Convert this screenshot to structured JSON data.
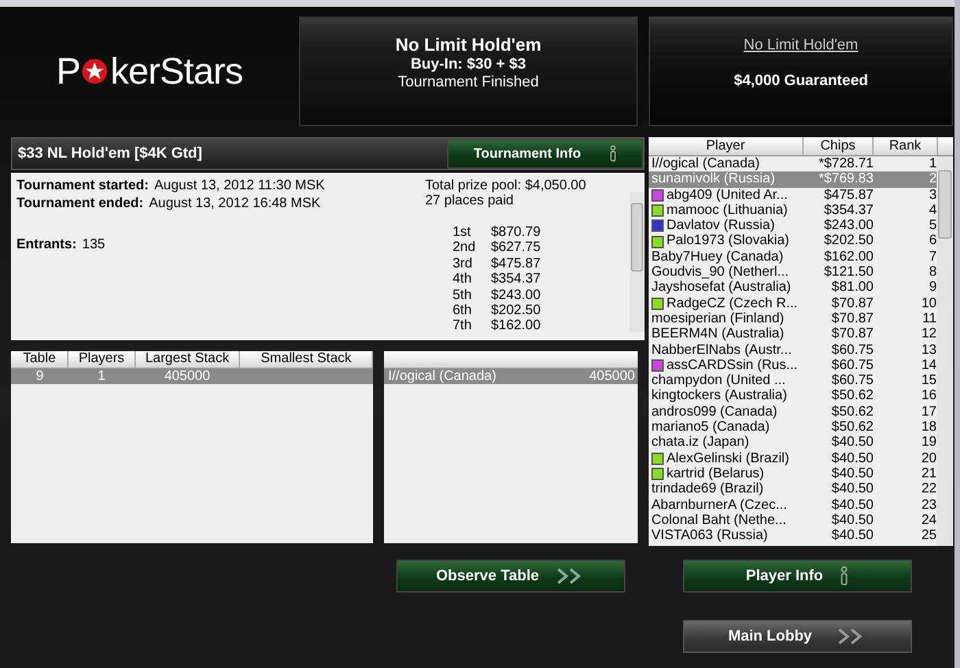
{
  "logo": {
    "before": "P",
    "after": "kerStars"
  },
  "game_panel": {
    "title": "No Limit Hold'em",
    "buy_in": "Buy-In: $30 + $3",
    "status": "Tournament Finished"
  },
  "promo_panel": {
    "link": "No Limit Hold'em",
    "guarantee": "$4,000 Guaranteed"
  },
  "tournament": {
    "name": "$33 NL Hold'em [$4K Gtd]",
    "info_button": "Tournament Info",
    "details": [
      {
        "label": "Tournament started:",
        "value": "August 13, 2012 11:30 MSK"
      },
      {
        "label": "Tournament ended:",
        "value": "August 13, 2012 16:48 MSK"
      },
      {
        "label": "Entrants:",
        "value": "135"
      }
    ],
    "prize_pool": "Total prize pool: $4,050.00",
    "places_paid": "27 places paid",
    "payouts": [
      {
        "place": "1st",
        "amount": "$870.79"
      },
      {
        "place": "2nd",
        "amount": "$627.75"
      },
      {
        "place": "3rd",
        "amount": "$475.87"
      },
      {
        "place": "4th",
        "amount": "$354.37"
      },
      {
        "place": "5th",
        "amount": "$243.00"
      },
      {
        "place": "6th",
        "amount": "$202.50"
      },
      {
        "place": "7th",
        "amount": "$162.00"
      }
    ]
  },
  "tables": {
    "columns": [
      "Table",
      "Players",
      "Largest Stack",
      "Smallest Stack"
    ],
    "rows": [
      {
        "table": "9",
        "players": "1",
        "largest": "405000",
        "selected": true
      }
    ]
  },
  "table_players": {
    "rows": [
      {
        "name": "I//ogical (Canada)",
        "chips": "405000",
        "selected": true
      }
    ]
  },
  "players": {
    "columns": [
      "Player",
      "Chips",
      "Rank"
    ],
    "rows": [
      {
        "name": "I//ogical (Canada)",
        "chips": "*$728.71",
        "rank": "1",
        "selected": false
      },
      {
        "name": "sunamivolk (Russia)",
        "chips": "*$769.83",
        "rank": "2",
        "selected": true
      },
      {
        "name": "abg409 (United Ar...",
        "chips": "$475.87",
        "rank": "3",
        "selected": false,
        "color": "#cc44dd"
      },
      {
        "name": "mamooc (Lithuania)",
        "chips": "$354.37",
        "rank": "4",
        "selected": false,
        "color": "#88dd22"
      },
      {
        "name": "Davlatov (Russia)",
        "chips": "$243.00",
        "rank": "5",
        "selected": false,
        "color": "#3333cc"
      },
      {
        "name": "Palo1973 (Slovakia)",
        "chips": "$202.50",
        "rank": "6",
        "selected": false,
        "color": "#88dd22"
      },
      {
        "name": "Baby7Huey (Canada)",
        "chips": "$162.00",
        "rank": "7",
        "selected": false
      },
      {
        "name": "Goudvis_90 (Netherl...",
        "chips": "$121.50",
        "rank": "8",
        "selected": false
      },
      {
        "name": "Jayshosefat (Australia)",
        "chips": "$81.00",
        "rank": "9",
        "selected": false
      },
      {
        "name": "RadgeCZ (Czech R...",
        "chips": "$70.87",
        "rank": "10",
        "selected": false,
        "color": "#88dd22"
      },
      {
        "name": "moesiperian (Finland)",
        "chips": "$70.87",
        "rank": "11",
        "selected": false
      },
      {
        "name": "BEERM4N (Australia)",
        "chips": "$70.87",
        "rank": "12",
        "selected": false
      },
      {
        "name": "NabberElNabs (Austr...",
        "chips": "$60.75",
        "rank": "13",
        "selected": false
      },
      {
        "name": "assCARDSsin (Rus...",
        "chips": "$60.75",
        "rank": "14",
        "selected": false,
        "color": "#cc44dd"
      },
      {
        "name": "champydon (United ...",
        "chips": "$60.75",
        "rank": "15",
        "selected": false
      },
      {
        "name": "kingtockers (Australia)",
        "chips": "$50.62",
        "rank": "16",
        "selected": false
      },
      {
        "name": "andros099 (Canada)",
        "chips": "$50.62",
        "rank": "17",
        "selected": false
      },
      {
        "name": "mariano5 (Canada)",
        "chips": "$50.62",
        "rank": "18",
        "selected": false
      },
      {
        "name": "chata.iz (Japan)",
        "chips": "$40.50",
        "rank": "19",
        "selected": false
      },
      {
        "name": "AlexGelinski (Brazil)",
        "chips": "$40.50",
        "rank": "20",
        "selected": false,
        "color": "#88dd22"
      },
      {
        "name": "kartrid (Belarus)",
        "chips": "$40.50",
        "rank": "21",
        "selected": false,
        "color": "#88dd22"
      },
      {
        "name": "trindade69 (Brazil)",
        "chips": "$40.50",
        "rank": "22",
        "selected": false
      },
      {
        "name": "AbarnburnerA (Czec...",
        "chips": "$40.50",
        "rank": "23",
        "selected": false
      },
      {
        "name": "Colonal Baht (Nethe...",
        "chips": "$40.50",
        "rank": "24",
        "selected": false
      },
      {
        "name": "VISTA063 (Russia)",
        "chips": "$40.50",
        "rank": "25",
        "selected": false
      }
    ]
  },
  "buttons": {
    "observe": "Observe Table",
    "player_info": "Player Info",
    "main_lobby": "Main Lobby"
  }
}
